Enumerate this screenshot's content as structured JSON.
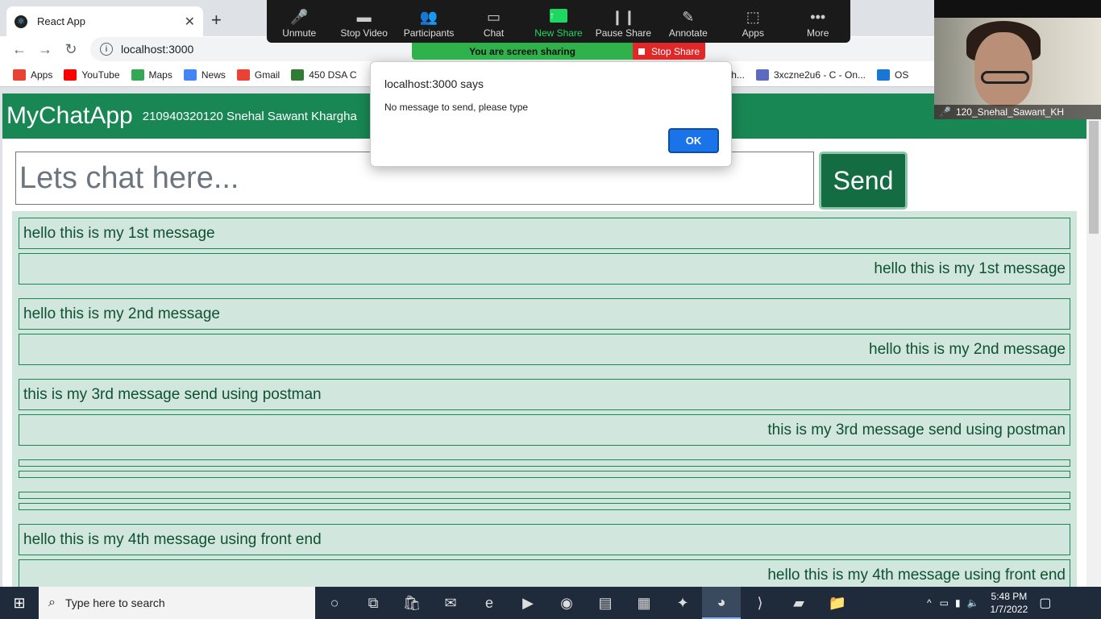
{
  "browser": {
    "tab_title": "React App",
    "tab_close": "✕",
    "new_tab": "+",
    "url": "localhost:3000",
    "bookmarks": [
      {
        "label": "Apps",
        "color": "#e94235"
      },
      {
        "label": "YouTube",
        "color": "#ff0000"
      },
      {
        "label": "Maps",
        "color": "#34a853"
      },
      {
        "label": "News",
        "color": "#4285f4"
      },
      {
        "label": "Gmail",
        "color": "#ea4335"
      },
      {
        "label": "450 DSA C",
        "color": "#2e7d32"
      },
      {
        "label": "nwagh...",
        "color": "#888888"
      },
      {
        "label": "3xczne2u6 - C - On...",
        "color": "#5c6bc0"
      },
      {
        "label": "OS",
        "color": "#1976d2"
      }
    ]
  },
  "app": {
    "brand": "MyChatApp",
    "author": "210940320120 Snehal Sawant Khargha",
    "input_placeholder": "Lets chat here...",
    "send_label": "Send",
    "messages": [
      {
        "text": "hello this is my 1st message",
        "align": "left"
      },
      {
        "text": "hello this is my 1st message",
        "align": "right"
      },
      {
        "text": "hello this is my 2nd message",
        "align": "left"
      },
      {
        "text": "hello this is my 2nd message",
        "align": "right"
      },
      {
        "text": "this is my 3rd message send using postman",
        "align": "left"
      },
      {
        "text": "this is my 3rd message send using postman",
        "align": "right"
      },
      {
        "text": "",
        "align": "left"
      },
      {
        "text": "",
        "align": "right"
      },
      {
        "text": "",
        "align": "left"
      },
      {
        "text": "",
        "align": "right"
      },
      {
        "text": "hello this is my 4th message using front end",
        "align": "left"
      },
      {
        "text": "hello this is my 4th message using front end",
        "align": "right"
      }
    ]
  },
  "dialog": {
    "title": "localhost:3000 says",
    "message": "No message to send, please type",
    "ok_label": "OK"
  },
  "zoom": {
    "buttons": [
      {
        "label": "Unmute",
        "icon": "microphone-muted-icon",
        "glyph": "🎤"
      },
      {
        "label": "Stop Video",
        "icon": "video-camera-icon",
        "glyph": "▬"
      },
      {
        "label": "Participants",
        "icon": "participants-icon",
        "glyph": "👥",
        "badge": "1"
      },
      {
        "label": "Chat",
        "icon": "chat-bubble-icon",
        "glyph": "▭"
      },
      {
        "label": "New Share",
        "icon": "share-arrow-icon",
        "glyph": "↑"
      },
      {
        "label": "Pause Share",
        "icon": "pause-icon",
        "glyph": "❙❙"
      },
      {
        "label": "Annotate",
        "icon": "pencil-icon",
        "glyph": "✎"
      },
      {
        "label": "Apps",
        "icon": "apps-icon",
        "glyph": "⬚"
      },
      {
        "label": "More",
        "icon": "more-dots-icon",
        "glyph": "•••"
      }
    ],
    "sharing_banner": "You are screen sharing",
    "stop_share": "Stop Share",
    "participant_name": "120_Snehal_Sawant_KH"
  },
  "taskbar": {
    "search_placeholder": "Type here to search",
    "time": "5:48 PM",
    "date": "1/7/2022"
  }
}
